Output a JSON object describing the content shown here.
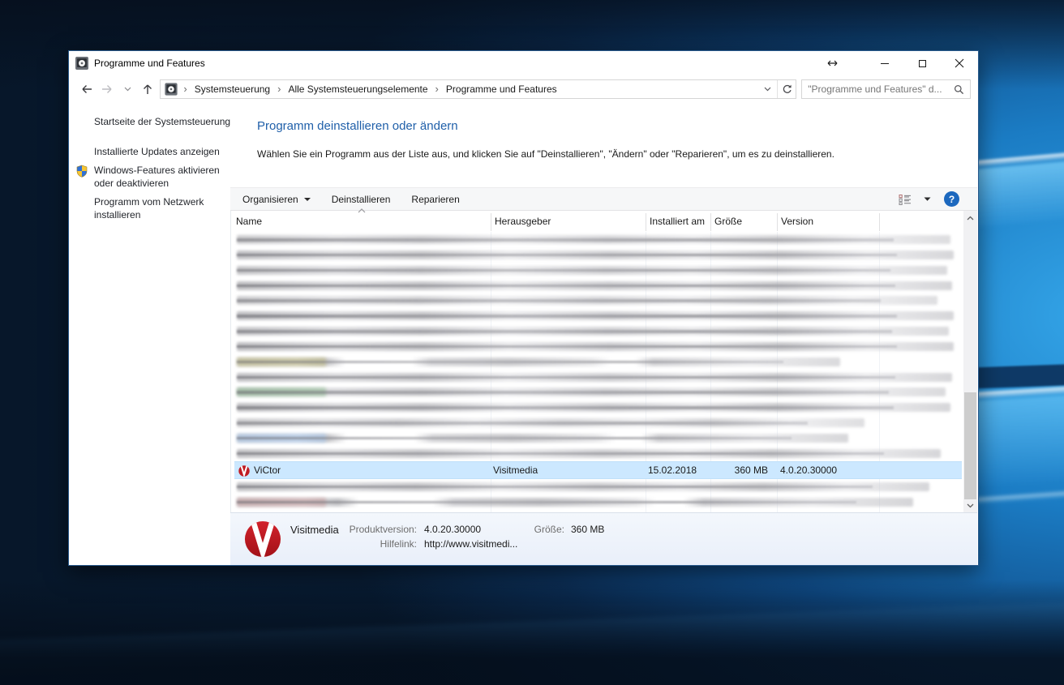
{
  "window": {
    "title": "Programme und Features"
  },
  "navbar": {
    "breadcrumb": [
      "Systemsteuerung",
      "Alle Systemsteuerungselemente",
      "Programme und Features"
    ],
    "search_placeholder": "\"Programme und Features\" d..."
  },
  "sidebar": {
    "items": [
      {
        "label": "Startseite der Systemsteuerung"
      },
      {
        "label": "Installierte Updates anzeigen"
      },
      {
        "label": "Windows-Features aktivieren oder deaktivieren",
        "icon": "uac-shield"
      },
      {
        "label": "Programm vom Netzwerk installieren"
      }
    ]
  },
  "main": {
    "heading": "Programm deinstallieren oder ändern",
    "description": "Wählen Sie ein Programm aus der Liste aus, und klicken Sie auf \"Deinstallieren\", \"Ändern\" oder \"Reparieren\", um es zu deinstallieren.",
    "toolbar": {
      "items": [
        "Organisieren",
        "Deinstallieren",
        "Reparieren"
      ],
      "help_glyph": "?"
    },
    "columns": [
      "Name",
      "Herausgeber",
      "Installiert am",
      "Größe",
      "Version"
    ],
    "sort": {
      "column": "Name",
      "direction": "ascending"
    },
    "list": {
      "redacted_rows_above": 15,
      "redacted_rows_below": 2,
      "selected_program": {
        "name": "ViCtor",
        "publisher": "Visitmedia",
        "installed_on": "15.02.2018",
        "size": "360 MB",
        "version": "4.0.20.30000"
      }
    }
  },
  "details_pane": {
    "name": "Visitmedia",
    "product_version_label": "Produktversion:",
    "product_version": "4.0.20.30000",
    "size_label": "Größe:",
    "size": "360 MB",
    "help_link_label": "Hilfelink:",
    "help_link": "http://www.visitmedi..."
  },
  "colors": {
    "selection_background": "#cce8ff",
    "heading_blue": "#1f5fa9",
    "help_button_blue": "#1c68be",
    "logo_red": "#c01b22",
    "titlebar_background": "#ffffff",
    "desktop_base": "#0b2a4d"
  }
}
